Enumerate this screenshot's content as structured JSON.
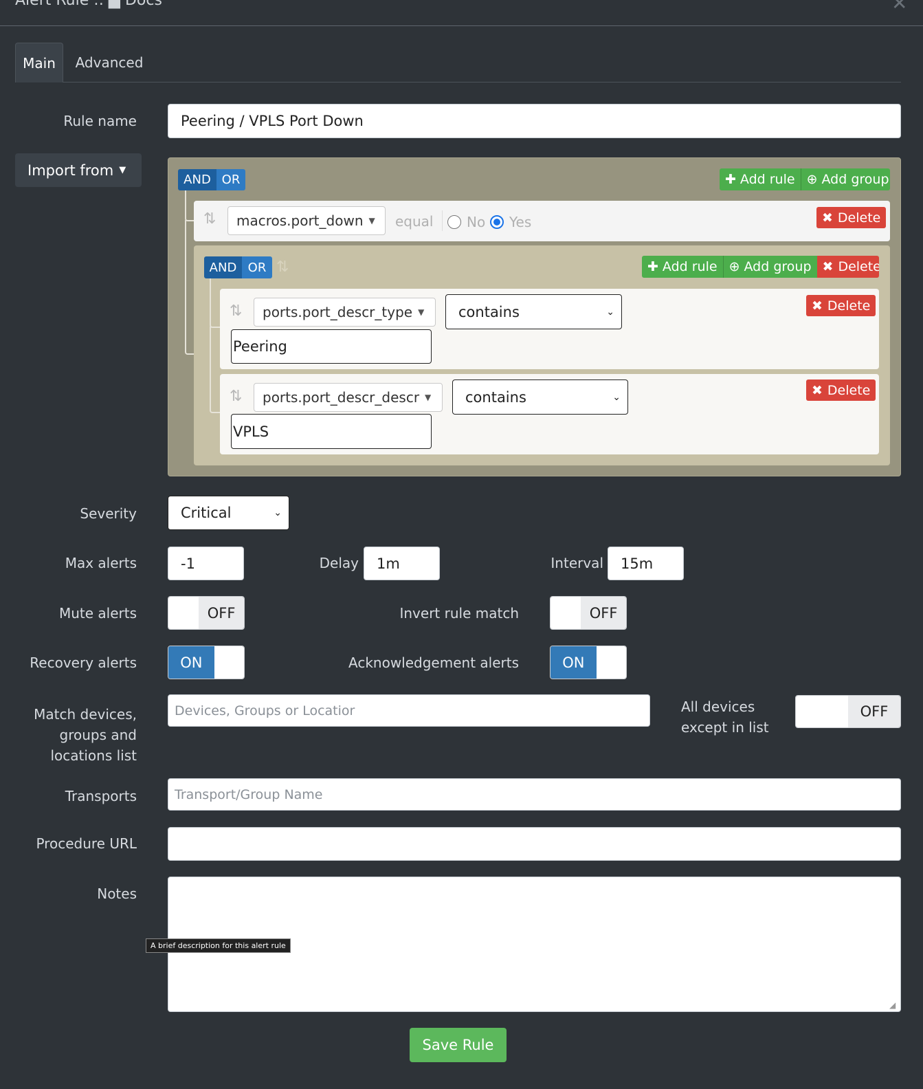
{
  "header": {
    "title": "Alert Rule :: ▆ Docs",
    "close_icon": "close-icon"
  },
  "tabs": [
    {
      "label": "Main",
      "active": true
    },
    {
      "label": "Advanced",
      "active": false
    }
  ],
  "form": {
    "rule_name_label": "Rule name",
    "rule_name_value": "Peering / VPLS Port Down",
    "import_label": "Import from",
    "severity_label": "Severity",
    "severity_value": "Critical",
    "max_alerts_label": "Max alerts",
    "max_alerts_value": "-1",
    "delay_label": "Delay",
    "delay_value": "1m",
    "interval_label": "Interval",
    "interval_value": "15m",
    "mute_label": "Mute alerts",
    "mute_value": "OFF",
    "invert_label": "Invert rule match",
    "invert_value": "OFF",
    "recovery_label": "Recovery alerts",
    "recovery_value": "ON",
    "ack_label": "Acknowledgement alerts",
    "ack_value": "ON",
    "match_label_1": "Match devices,",
    "match_label_2": "groups and",
    "match_label_3": "locations list",
    "match_placeholder": "Devices, Groups or Locatior",
    "all_devices_label_1": "All devices",
    "all_devices_label_2": "except in list",
    "all_devices_value": "OFF",
    "transports_label": "Transports",
    "transports_placeholder": "Transport/Group Name",
    "procedure_label": "Procedure URL",
    "procedure_value": "",
    "notes_label": "Notes",
    "notes_tooltip": "A brief description for this alert rule",
    "save_label": "Save Rule"
  },
  "builder": {
    "and_label": "AND",
    "or_label": "OR",
    "add_rule_label": "Add rule",
    "add_group_label": "Add group",
    "delete_label": "Delete",
    "rule1": {
      "field": "macros.port_down",
      "operator": "equal",
      "radio_no": "No",
      "radio_yes": "Yes",
      "selected": "Yes"
    },
    "rule2": {
      "field": "ports.port_descr_type",
      "operator": "contains",
      "value": "Peering"
    },
    "rule3": {
      "field": "ports.port_descr_descr",
      "operator": "contains",
      "value": "VPLS"
    }
  }
}
